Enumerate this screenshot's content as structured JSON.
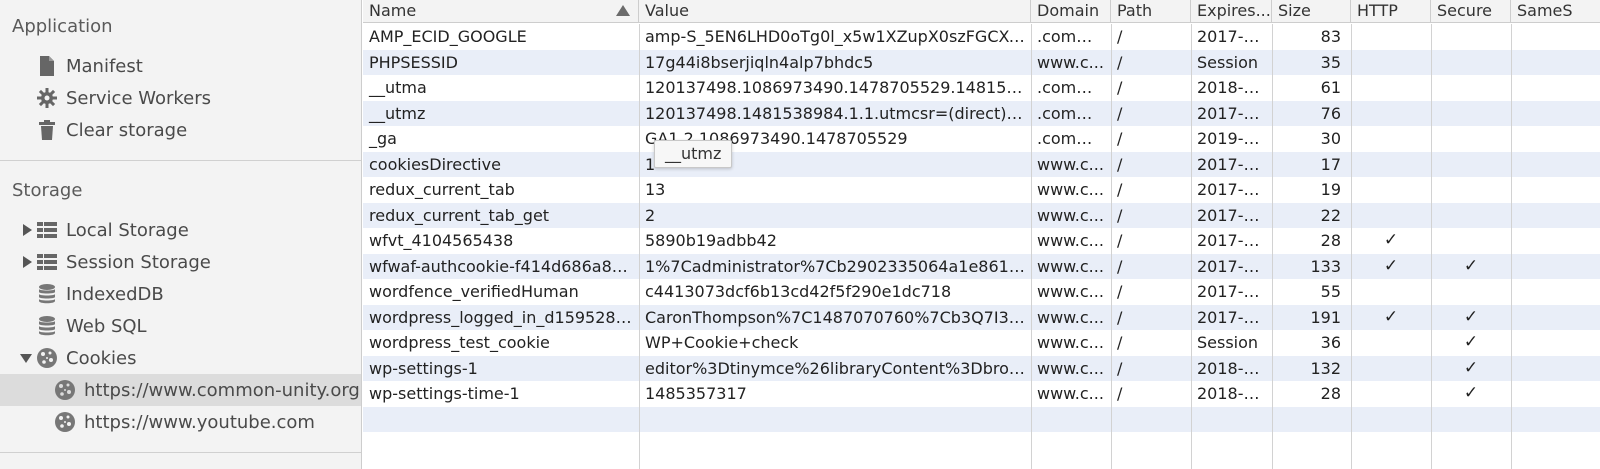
{
  "sidebar": {
    "application_title": "Application",
    "application_items": [
      {
        "label": "Manifest",
        "icon": "document-icon"
      },
      {
        "label": "Service Workers",
        "icon": "gear-icon"
      },
      {
        "label": "Clear storage",
        "icon": "trash-icon"
      }
    ],
    "storage_title": "Storage",
    "storage_items": [
      {
        "label": "Local Storage",
        "icon": "grid-icon",
        "expander": "collapsed"
      },
      {
        "label": "Session Storage",
        "icon": "grid-icon",
        "expander": "collapsed"
      },
      {
        "label": "IndexedDB",
        "icon": "database-icon"
      },
      {
        "label": "Web SQL",
        "icon": "database-icon"
      },
      {
        "label": "Cookies",
        "icon": "cookie-icon",
        "expander": "expanded"
      }
    ],
    "cookie_sites": [
      {
        "label": "https://www.common-unity.org",
        "selected": true
      },
      {
        "label": "https://www.youtube.com",
        "selected": false
      }
    ]
  },
  "table": {
    "columns": [
      "Name",
      "Value",
      "Domain",
      "Path",
      "Expires...",
      "Size",
      "HTTP",
      "Secure",
      "SameS"
    ],
    "rows": [
      {
        "name": "AMP_ECID_GOOGLE",
        "value": "amp-S_5EN6LHD0oTg0l_x5w1XZupX0szFGCXel...",
        "domain": ".comm...",
        "path": "/",
        "expires": "2017-1...",
        "size": "83",
        "http": "",
        "secure": ""
      },
      {
        "name": "PHPSESSID",
        "value": "17g44i8bserjiqln4alp7bhdc5",
        "domain": "www.c...",
        "path": "/",
        "expires": "Session",
        "size": "35",
        "http": "",
        "secure": ""
      },
      {
        "name": "__utma",
        "value": "120137498.1086973490.1478705529.14815389...",
        "domain": ".comm...",
        "path": "/",
        "expires": "2018-1...",
        "size": "61",
        "http": "",
        "secure": ""
      },
      {
        "name": "__utmz",
        "value": "120137498.1481538984.1.1.utmcsr=(direct)|utm...",
        "domain": ".comm...",
        "path": "/",
        "expires": "2017-0...",
        "size": "76",
        "http": "",
        "secure": ""
      },
      {
        "name": "_ga",
        "value": "GA1.2.1086973490.1478705529",
        "domain": ".comm...",
        "path": "/",
        "expires": "2019-0...",
        "size": "30",
        "http": "",
        "secure": ""
      },
      {
        "name": "cookiesDirective",
        "value": "1",
        "domain": "www.c...",
        "path": "/",
        "expires": "2017-1...",
        "size": "17",
        "http": "",
        "secure": ""
      },
      {
        "name": "redux_current_tab",
        "value": "13",
        "domain": "www.c...",
        "path": "/",
        "expires": "2017-0...",
        "size": "19",
        "http": "",
        "secure": ""
      },
      {
        "name": "redux_current_tab_get",
        "value": "2",
        "domain": "www.c...",
        "path": "/",
        "expires": "2017-0...",
        "size": "22",
        "http": "",
        "secure": ""
      },
      {
        "name": "wfvt_4104565438",
        "value": "5890b19adbb42",
        "domain": "www.c...",
        "path": "/",
        "expires": "2017-0...",
        "size": "28",
        "http": "✓",
        "secure": ""
      },
      {
        "name": "wfwaf-authcookie-f414d686a86...",
        "value": "1%7Cadministrator%7Cb2902335064a1e8618e...",
        "domain": "www.c...",
        "path": "/",
        "expires": "2017-0...",
        "size": "133",
        "http": "✓",
        "secure": "✓"
      },
      {
        "name": "wordfence_verifiedHuman",
        "value": "c4413073dcf6b13cd42f5f290e1dc718",
        "domain": "www.c...",
        "path": "/",
        "expires": "2017-0...",
        "size": "55",
        "http": "",
        "secure": ""
      },
      {
        "name": "wordpress_logged_in_d1595287...",
        "value": "CaronThompson%7C1487070760%7Cb3Q7I3yu...",
        "domain": "www.c...",
        "path": "/",
        "expires": "2017-0...",
        "size": "191",
        "http": "✓",
        "secure": "✓"
      },
      {
        "name": "wordpress_test_cookie",
        "value": "WP+Cookie+check",
        "domain": "www.c...",
        "path": "/",
        "expires": "Session",
        "size": "36",
        "http": "",
        "secure": "✓"
      },
      {
        "name": "wp-settings-1",
        "value": "editor%3Dtinymce%26libraryContent%3Dbrow...",
        "domain": "www.c...",
        "path": "/",
        "expires": "2018-0...",
        "size": "132",
        "http": "",
        "secure": "✓"
      },
      {
        "name": "wp-settings-time-1",
        "value": "1485357317",
        "domain": "www.c...",
        "path": "/",
        "expires": "2018-0...",
        "size": "28",
        "http": "",
        "secure": "✓"
      }
    ],
    "tooltip": "__utmz"
  },
  "colors": {
    "sidebar_bg": "#f3f3f3",
    "row_alt": "#e9eef8",
    "selected_bg": "#dcdcdc"
  }
}
